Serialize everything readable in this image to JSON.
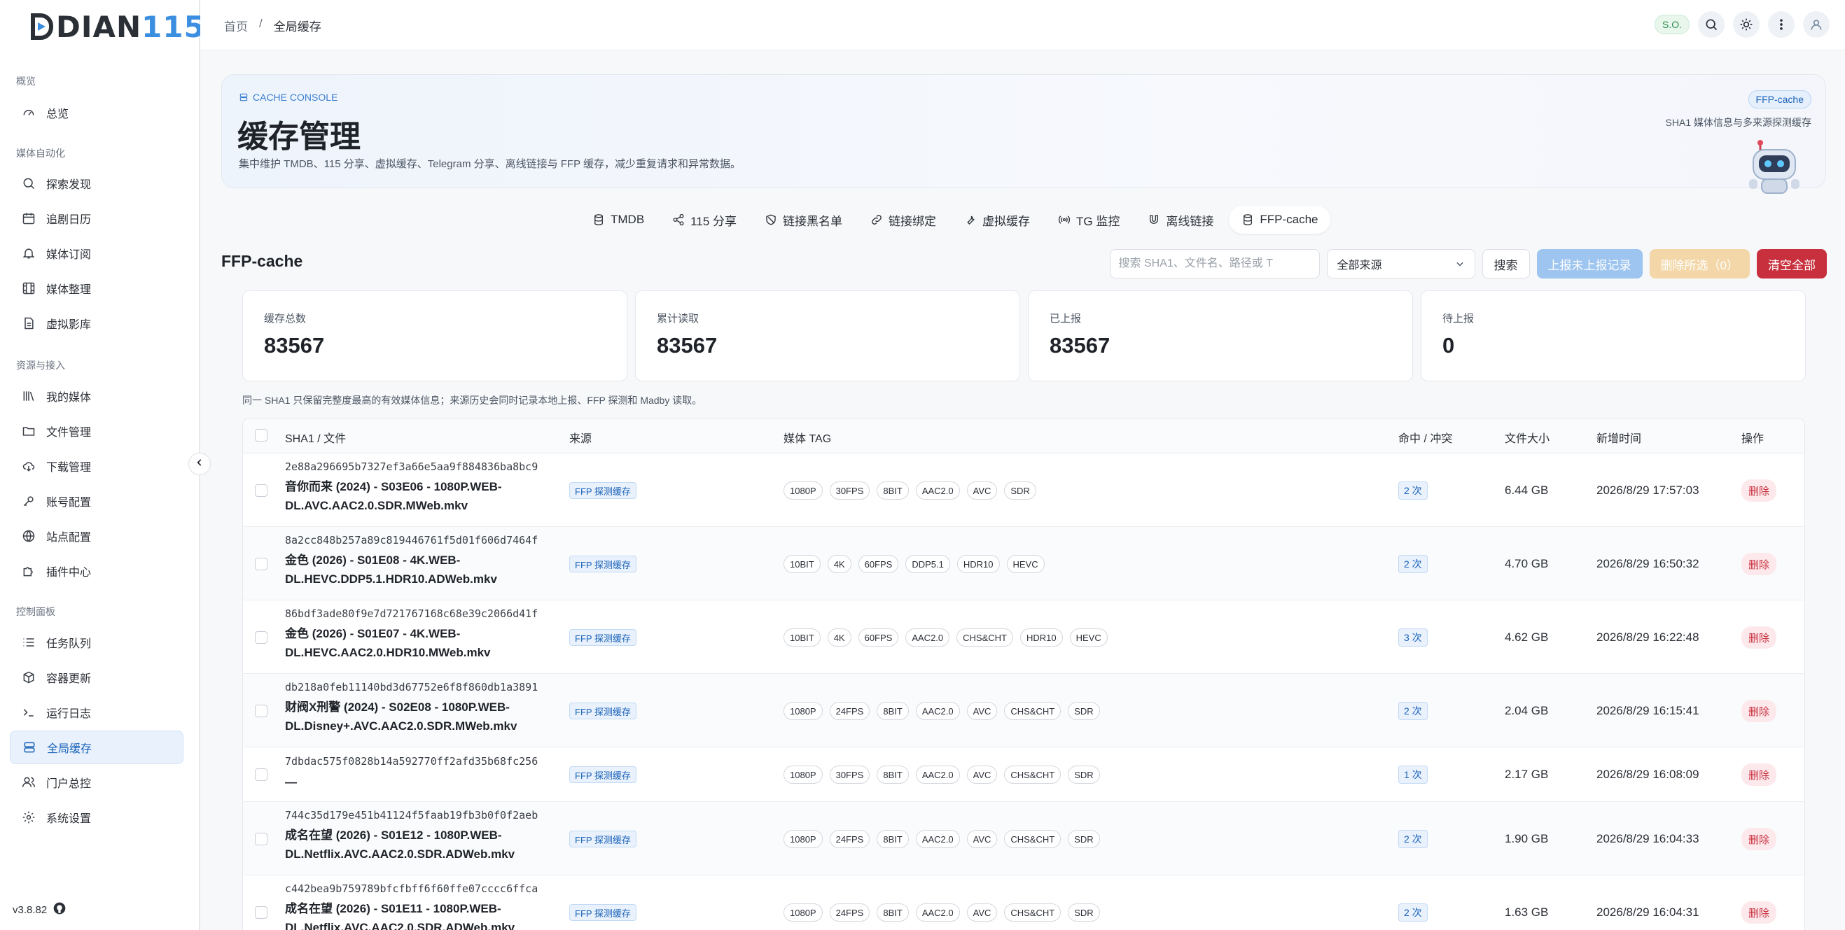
{
  "app": {
    "logo_part1": "DIAN",
    "logo_part2": "115",
    "version": "v3.8.82"
  },
  "sidebar": {
    "sections": [
      {
        "title": "概览",
        "items": [
          {
            "label": "总览",
            "icon": "gauge-icon"
          }
        ]
      },
      {
        "title": "媒体自动化",
        "items": [
          {
            "label": "探索发现",
            "icon": "search-icon"
          },
          {
            "label": "追剧日历",
            "icon": "calendar-icon"
          },
          {
            "label": "媒体订阅",
            "icon": "bell-icon"
          },
          {
            "label": "媒体整理",
            "icon": "film-icon"
          },
          {
            "label": "虚拟影库",
            "icon": "file-icon"
          }
        ]
      },
      {
        "title": "资源与接入",
        "items": [
          {
            "label": "我的媒体",
            "icon": "library-icon"
          },
          {
            "label": "文件管理",
            "icon": "folder-icon"
          },
          {
            "label": "下载管理",
            "icon": "cloud-download-icon"
          },
          {
            "label": "账号配置",
            "icon": "key-icon"
          },
          {
            "label": "站点配置",
            "icon": "globe-icon"
          },
          {
            "label": "插件中心",
            "icon": "puzzle-icon"
          }
        ]
      },
      {
        "title": "控制面板",
        "items": [
          {
            "label": "任务队列",
            "icon": "list-icon"
          },
          {
            "label": "容器更新",
            "icon": "box-icon"
          },
          {
            "label": "运行日志",
            "icon": "terminal-icon"
          },
          {
            "label": "全局缓存",
            "icon": "database-icon",
            "active": true
          },
          {
            "label": "门户总控",
            "icon": "users-icon"
          },
          {
            "label": "系统设置",
            "icon": "gear-icon"
          }
        ]
      }
    ]
  },
  "topbar": {
    "breadcrumb": [
      "首页",
      "/",
      "全局缓存"
    ],
    "badge": "S.O."
  },
  "hero": {
    "tag": "CACHE CONSOLE",
    "title": "缓存管理",
    "description": "集中维护 TMDB、115 分享、虚拟缓存、Telegram 分享、离线链接与 FFP 缓存，减少重复请求和异常数据。",
    "pill": "FFP-cache",
    "subtitle": "SHA1 媒体信息与多来源探测缓存"
  },
  "tabs": [
    {
      "label": "TMDB",
      "icon": "database-icon"
    },
    {
      "label": "115 分享",
      "icon": "share-icon"
    },
    {
      "label": "链接黑名单",
      "icon": "ban-icon"
    },
    {
      "label": "链接绑定",
      "icon": "link-icon"
    },
    {
      "label": "虚拟缓存",
      "icon": "wrench-icon"
    },
    {
      "label": "TG 监控",
      "icon": "broadcast-icon"
    },
    {
      "label": "离线链接",
      "icon": "magnet-icon"
    },
    {
      "label": "FFP-cache",
      "icon": "database-icon",
      "active": true
    }
  ],
  "section": {
    "title": "FFP-cache",
    "search_placeholder": "搜索 SHA1、文件名、路径或 T",
    "source_select": "全部来源",
    "search_button": "搜索",
    "report_button": "上报未上报记录",
    "delete_selected_button": "删除所选（0）",
    "clear_all_button": "清空全部"
  },
  "stats": [
    {
      "label": "缓存总数",
      "value": "83567"
    },
    {
      "label": "累计读取",
      "value": "83567"
    },
    {
      "label": "已上报",
      "value": "83567"
    },
    {
      "label": "待上报",
      "value": "0"
    }
  ],
  "note": "同一 SHA1 只保留完整度最高的有效媒体信息；来源历史会同时记录本地上报、FFP 探测和 Madby 读取。",
  "table": {
    "headers": [
      "SHA1 / 文件",
      "来源",
      "媒体 TAG",
      "命中 / 冲突",
      "文件大小",
      "新增时间",
      "操作"
    ],
    "rows": [
      {
        "sha1": "2e88a296695b7327ef3a66e5aa9f884836ba8bc9",
        "name": "音你而来 (2024) - S03E06 - 1080P.WEB-DL.AVC.AAC2.0.SDR.MWeb.mkv",
        "source": "FFP 探测缓存",
        "tags": [
          "1080P",
          "30FPS",
          "8BIT",
          "AAC2.0",
          "AVC",
          "SDR"
        ],
        "hits": "2 次",
        "size": "6.44 GB",
        "time": "2026/8/29 17:57:03",
        "action": "删除"
      },
      {
        "sha1": "8a2cc848b257a89c819446761f5d01f606d7464f",
        "name": "金色 (2026) - S01E08 - 4K.WEB-DL.HEVC.DDP5.1.HDR10.ADWeb.mkv",
        "source": "FFP 探测缓存",
        "tags": [
          "10BIT",
          "4K",
          "60FPS",
          "DDP5.1",
          "HDR10",
          "HEVC"
        ],
        "hits": "2 次",
        "size": "4.70 GB",
        "time": "2026/8/29 16:50:32",
        "action": "删除"
      },
      {
        "sha1": "86bdf3ade80f9e7d721767168c68e39c2066d41f",
        "name": "金色 (2026) - S01E07 - 4K.WEB-DL.HEVC.AAC2.0.HDR10.MWeb.mkv",
        "source": "FFP 探测缓存",
        "tags": [
          "10BIT",
          "4K",
          "60FPS",
          "AAC2.0",
          "CHS&CHT",
          "HDR10",
          "HEVC"
        ],
        "hits": "3 次",
        "size": "4.62 GB",
        "time": "2026/8/29 16:22:48",
        "action": "删除"
      },
      {
        "sha1": "db218a0feb11140bd3d67752e6f8f860db1a3891",
        "name": "财阀X刑警 (2024) - S02E08 - 1080P.WEB-DL.Disney+.AVC.AAC2.0.SDR.MWeb.mkv",
        "source": "FFP 探测缓存",
        "tags": [
          "1080P",
          "24FPS",
          "8BIT",
          "AAC2.0",
          "AVC",
          "CHS&CHT",
          "SDR"
        ],
        "hits": "2 次",
        "size": "2.04 GB",
        "time": "2026/8/29 16:15:41",
        "action": "删除"
      },
      {
        "sha1": "7dbdac575f0828b14a592770ff2afd35b68fc256",
        "name": "—",
        "source": "FFP 探测缓存",
        "tags": [
          "1080P",
          "30FPS",
          "8BIT",
          "AAC2.0",
          "AVC",
          "CHS&CHT",
          "SDR"
        ],
        "hits": "1 次",
        "size": "2.17 GB",
        "time": "2026/8/29 16:08:09",
        "action": "删除"
      },
      {
        "sha1": "744c35d179e451b41124f5faab19fb3b0f0f2aeb",
        "name": "成名在望 (2026) - S01E12 - 1080P.WEB-DL.Netflix.AVC.AAC2.0.SDR.ADWeb.mkv",
        "source": "FFP 探测缓存",
        "tags": [
          "1080P",
          "24FPS",
          "8BIT",
          "AAC2.0",
          "AVC",
          "CHS&CHT",
          "SDR"
        ],
        "hits": "2 次",
        "size": "1.90 GB",
        "time": "2026/8/29 16:04:33",
        "action": "删除"
      },
      {
        "sha1": "c442bea9b759789bfcfbff6f60ffe07cccc6ffca",
        "name": "成名在望 (2026) - S01E11 - 1080P.WEB-DL.Netflix.AVC.AAC2.0.SDR.ADWeb.mkv",
        "source": "FFP 探测缓存",
        "tags": [
          "1080P",
          "24FPS",
          "8BIT",
          "AAC2.0",
          "AVC",
          "CHS&CHT",
          "SDR"
        ],
        "hits": "2 次",
        "size": "1.63 GB",
        "time": "2026/8/29 16:04:31",
        "action": "删除"
      }
    ]
  }
}
